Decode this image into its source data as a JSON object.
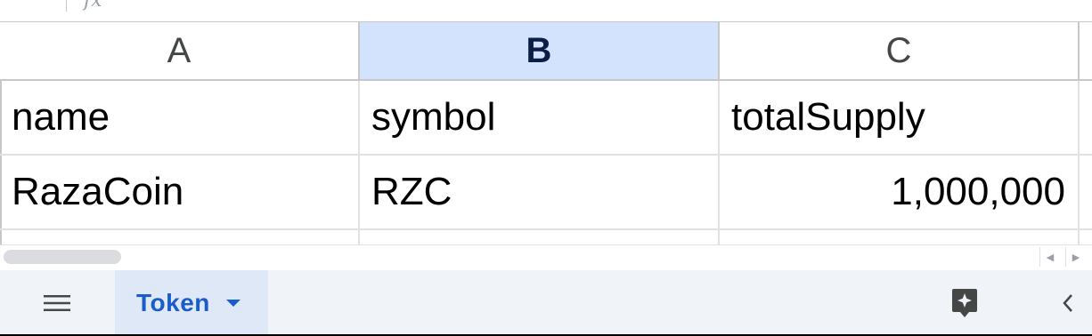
{
  "formula_bar": {
    "fx_icon": "fx",
    "fx_icon_name": "fx-icon"
  },
  "columns": [
    {
      "letter": "A",
      "selected": false
    },
    {
      "letter": "B",
      "selected": true
    },
    {
      "letter": "C",
      "selected": false
    }
  ],
  "rows": [
    [
      "name",
      "symbol",
      "totalSupply"
    ],
    [
      "RazaCoin",
      "RZC",
      "1,000,000"
    ]
  ],
  "sheet_tabs": [
    {
      "label": "Token",
      "active": true
    }
  ],
  "icons": {
    "menu": "hamburger-menu-icon",
    "tab_caret": "caret-down-icon",
    "explore": "explore-sparkle-icon",
    "collapse": "chevron-left-icon",
    "scroll_left": "scroll-left-icon",
    "scroll_right": "scroll-right-icon"
  },
  "colors": {
    "selected_header_bg": "#d3e3fd",
    "selected_header_text": "#0b1e47",
    "tab_bar_bg": "#f0f4f9",
    "active_tab_bg": "#dfe8f7",
    "active_tab_text": "#1a5dc8",
    "gridline": "#e1e1e1"
  }
}
